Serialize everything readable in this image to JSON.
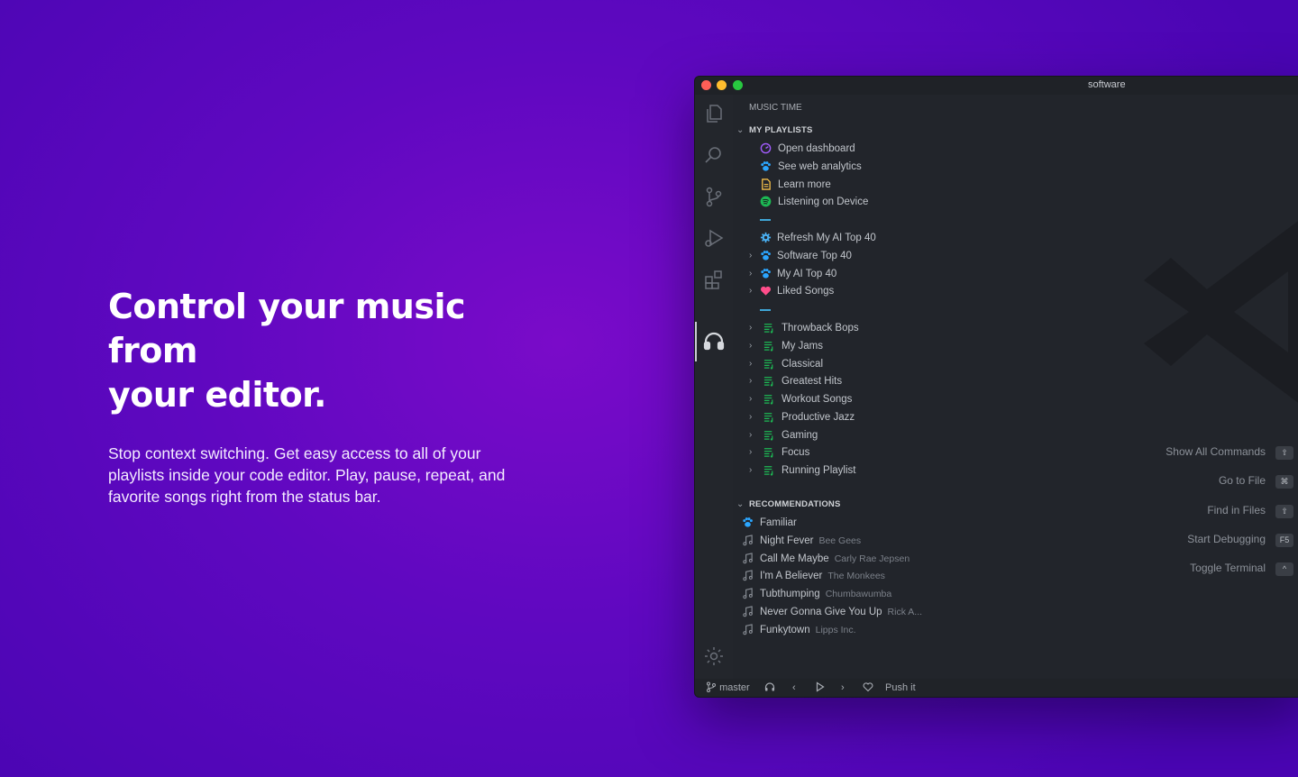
{
  "hero": {
    "title_line1": "Control your music from",
    "title_line2": "your editor.",
    "description": "Stop context switching. Get easy access to all of your playlists inside your code editor. Play, pause, repeat, and favorite songs right from the status bar."
  },
  "window": {
    "title": "software"
  },
  "sidebar": {
    "view_title": "MUSIC TIME",
    "my_playlists_title": "MY PLAYLISTS",
    "actions": [
      {
        "label": "Open dashboard",
        "icon": "dashboard-icon"
      },
      {
        "label": "See web analytics",
        "icon": "paw-icon"
      },
      {
        "label": "Learn more",
        "icon": "document-icon"
      },
      {
        "label": "Listening on Device",
        "icon": "spotify-icon"
      }
    ],
    "refresh_label": "Refresh My AI Top 40",
    "special_playlists": [
      {
        "label": "Software Top 40",
        "icon": "paw-icon"
      },
      {
        "label": "My AI Top 40",
        "icon": "paw-icon"
      },
      {
        "label": "Liked Songs",
        "icon": "heart-icon"
      }
    ],
    "playlists": [
      "Throwback Bops",
      "My Jams",
      "Classical",
      "Greatest Hits",
      "Workout Songs",
      "Productive Jazz",
      "Gaming",
      "Focus",
      "Running Playlist"
    ],
    "recommendations_title": "RECOMMENDATIONS",
    "recommendation_category": "Familiar",
    "songs": [
      {
        "title": "Night Fever",
        "artist": "Bee Gees"
      },
      {
        "title": "Call Me Maybe",
        "artist": "Carly Rae Jepsen"
      },
      {
        "title": "I'm A Believer",
        "artist": "The Monkees"
      },
      {
        "title": "Tubthumping",
        "artist": "Chumbawumba"
      },
      {
        "title": "Never Gonna Give You Up",
        "artist": "Rick A..."
      },
      {
        "title": "Funkytown",
        "artist": "Lipps Inc."
      }
    ]
  },
  "commands": [
    {
      "label": "Show All Commands",
      "key": "⇧"
    },
    {
      "label": "Go to File",
      "key": "⌘"
    },
    {
      "label": "Find in Files",
      "key": "⇧"
    },
    {
      "label": "Start Debugging",
      "key": "F5"
    },
    {
      "label": "Toggle Terminal",
      "key": "^"
    }
  ],
  "statusbar": {
    "branch": "master",
    "track": "Push it"
  },
  "colors": {
    "playlist_green": "#1db954",
    "paw_blue": "#2ba6ff",
    "heart_pink": "#ff4d8a",
    "dashboard_purple": "#a35cff"
  }
}
